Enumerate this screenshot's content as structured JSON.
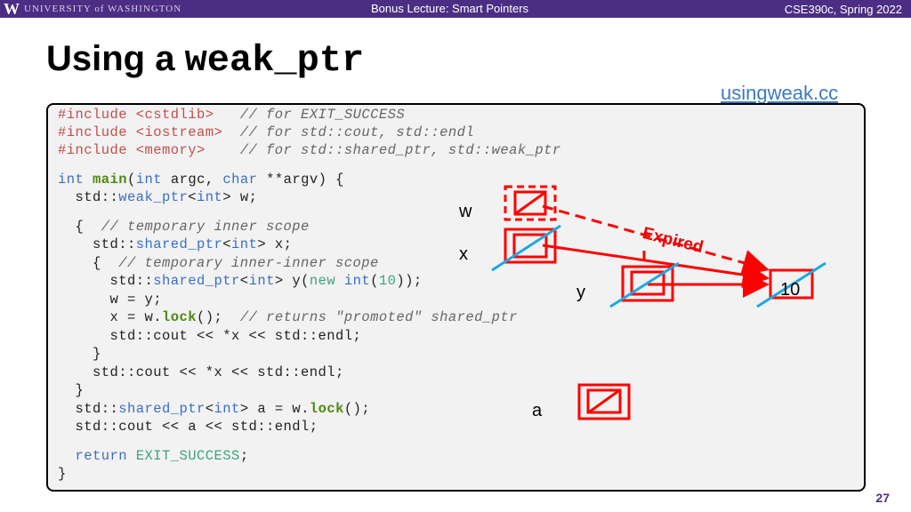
{
  "header": {
    "logo": "W",
    "university": "UNIVERSITY of WASHINGTON",
    "lecture": "Bonus Lecture: Smart Pointers",
    "course": "CSE390c, Spring 2022"
  },
  "slide": {
    "title_text": "Using a ",
    "title_code": "weak_ptr",
    "filename": "usingweak.cc",
    "page_number": "27"
  },
  "code": [
    [
      [
        "#include <cstdlib>   ",
        "pp"
      ],
      [
        "// for EXIT_SUCCESS",
        "cm"
      ]
    ],
    [
      [
        "#include <iostream>  ",
        "pp"
      ],
      [
        "// for std::cout, std::endl",
        "cm"
      ]
    ],
    [
      [
        "#include <memory>    ",
        "pp"
      ],
      [
        "// for std::shared_ptr, std::weak_ptr",
        "cm"
      ]
    ],
    [
      [
        "int ",
        "kw"
      ],
      [
        "main",
        "fn"
      ],
      [
        "(",
        ""
      ],
      [
        "int ",
        "kw"
      ],
      [
        "argc, ",
        ""
      ],
      [
        "char ",
        "kw"
      ],
      [
        "**argv) {",
        ""
      ]
    ],
    [
      [
        "  std::",
        ""
      ],
      [
        "weak_ptr",
        "kw"
      ],
      [
        "<",
        ""
      ],
      [
        "int",
        "kw"
      ],
      [
        "> w;",
        ""
      ]
    ],
    [
      [
        "  {  ",
        ""
      ],
      [
        "// temporary inner scope",
        "cm"
      ]
    ],
    [
      [
        "    std::",
        ""
      ],
      [
        "shared_ptr",
        "kw"
      ],
      [
        "<",
        ""
      ],
      [
        "int",
        "kw"
      ],
      [
        "> x;",
        ""
      ]
    ],
    [
      [
        "    {  ",
        ""
      ],
      [
        "// temporary inner-inner scope",
        "cm"
      ]
    ],
    [
      [
        "      std::",
        ""
      ],
      [
        "shared_ptr",
        "kw"
      ],
      [
        "<",
        ""
      ],
      [
        "int",
        "kw"
      ],
      [
        "> y(",
        ""
      ],
      [
        "new ",
        "lit"
      ],
      [
        "int",
        "kw"
      ],
      [
        "(",
        ""
      ],
      [
        "10",
        "lit"
      ],
      [
        "));",
        ""
      ]
    ],
    [
      [
        "      w = y;",
        ""
      ]
    ],
    [
      [
        "      x = w.",
        ""
      ],
      [
        "lock",
        "fn"
      ],
      [
        "();  ",
        ""
      ],
      [
        "// returns \"promoted\" shared_ptr",
        "cm"
      ]
    ],
    [
      [
        "      std::cout << *x << std::endl;",
        ""
      ]
    ],
    [
      [
        "    }",
        ""
      ]
    ],
    [
      [
        "    std::cout << *x << std::endl;",
        ""
      ]
    ],
    [
      [
        "  }",
        ""
      ]
    ],
    [
      [
        "  std::",
        ""
      ],
      [
        "shared_ptr",
        "kw"
      ],
      [
        "<",
        ""
      ],
      [
        "int",
        "kw"
      ],
      [
        "> a = w.",
        ""
      ],
      [
        "lock",
        "fn"
      ],
      [
        "();",
        ""
      ]
    ],
    [
      [
        "  std::cout << a << std::endl;",
        ""
      ]
    ],
    [
      [
        "  ",
        ""
      ],
      [
        "return ",
        "kw"
      ],
      [
        "EXIT_SUCCESS",
        "lit"
      ],
      [
        ";",
        ""
      ]
    ],
    [
      [
        "}",
        ""
      ]
    ]
  ],
  "diagram": {
    "labels": {
      "w": "w",
      "x": "x",
      "y": "y",
      "a": "a"
    },
    "value": "10",
    "annotation": "Expired",
    "colors": {
      "pointer": "#ff0000",
      "strike": "#1ea8e0"
    }
  }
}
